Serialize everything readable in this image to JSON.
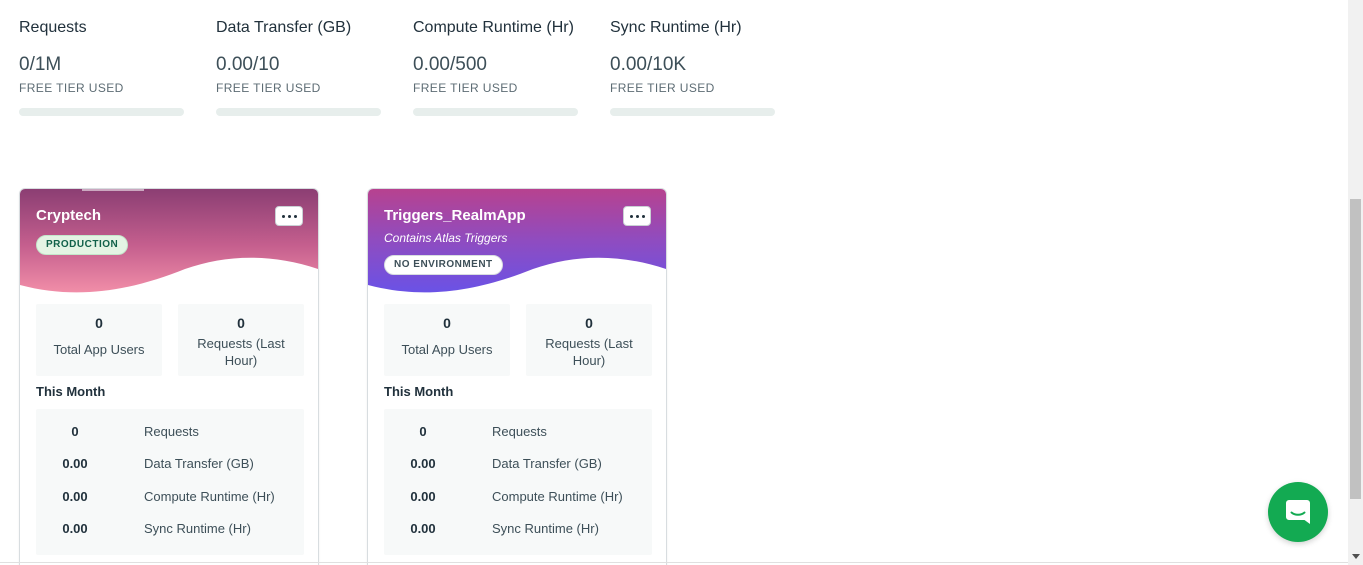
{
  "usage": [
    {
      "title": "Requests",
      "value": "0/1M",
      "caption": "FREE TIER USED",
      "fraction": 0
    },
    {
      "title": "Data Transfer (GB)",
      "value": "0.00/10",
      "caption": "FREE TIER USED",
      "fraction": 0
    },
    {
      "title": "Compute Runtime (Hr)",
      "value": "0.00/500",
      "caption": "FREE TIER USED",
      "fraction": 0
    },
    {
      "title": "Sync Runtime (Hr)",
      "value": "0.00/10K",
      "caption": "FREE TIER USED",
      "fraction": 0
    }
  ],
  "apps": [
    {
      "name": "Cryptech",
      "subtitle": "",
      "environment": "PRODUCTION",
      "gradient": [
        "#8b3e73",
        "#f18ea8"
      ],
      "total_users_value": "0",
      "total_users_label": "Total App Users",
      "requests_hour_value": "0",
      "requests_hour_label": "Requests (Last Hour)",
      "month_title": "This Month",
      "month": [
        {
          "value": "0",
          "label": "Requests"
        },
        {
          "value": "0.00",
          "label": "Data Transfer (GB)"
        },
        {
          "value": "0.00",
          "label": "Compute Runtime (Hr)"
        },
        {
          "value": "0.00",
          "label": "Sync Runtime (Hr)"
        }
      ]
    },
    {
      "name": "Triggers_RealmApp",
      "subtitle": "Contains Atlas Triggers",
      "environment": "NO ENVIRONMENT",
      "gradient": [
        "#b7428f",
        "#6a52e6"
      ],
      "total_users_value": "0",
      "total_users_label": "Total App Users",
      "requests_hour_value": "0",
      "requests_hour_label": "Requests (Last Hour)",
      "month_title": "This Month",
      "month": [
        {
          "value": "0",
          "label": "Requests"
        },
        {
          "value": "0.00",
          "label": "Data Transfer (GB)"
        },
        {
          "value": "0.00",
          "label": "Compute Runtime (Hr)"
        },
        {
          "value": "0.00",
          "label": "Sync Runtime (Hr)"
        }
      ]
    }
  ],
  "icons": {
    "menu": "ellipsis-icon",
    "chat": "chat-bubble-icon"
  },
  "colors": {
    "chat_launcher": "#13aa52",
    "usage_bar_track": "#e7eeec"
  }
}
